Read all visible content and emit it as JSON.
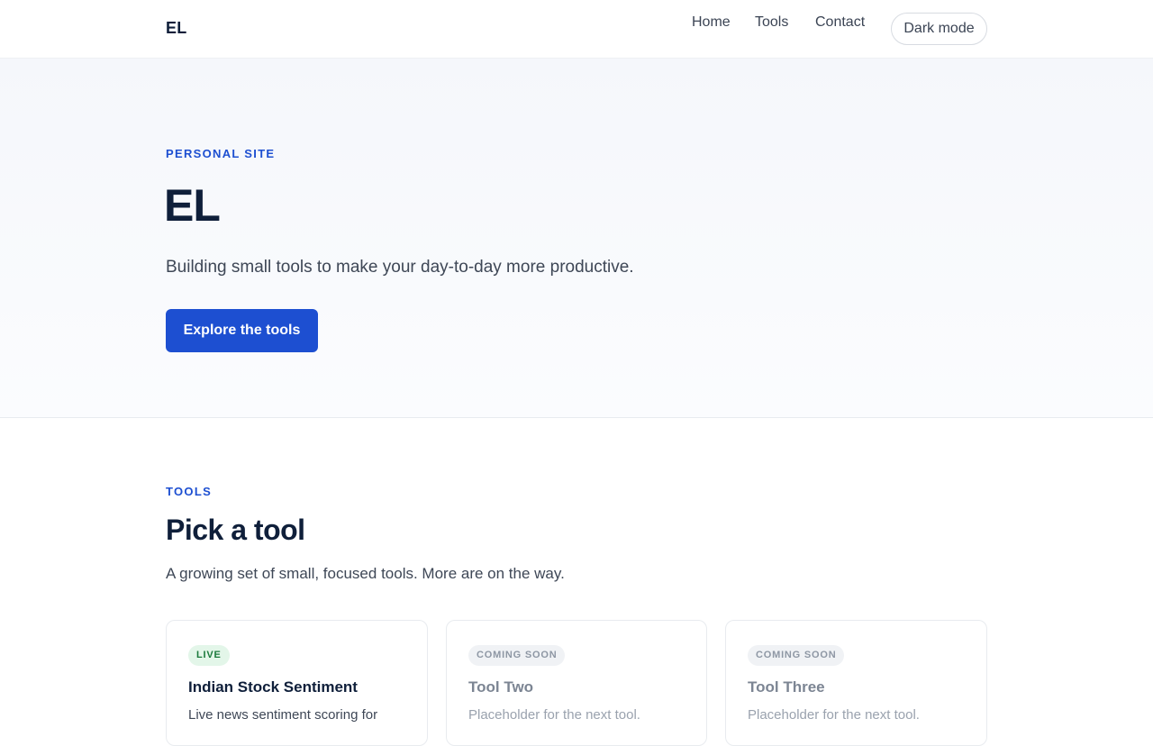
{
  "header": {
    "logo": "EL",
    "nav": [
      {
        "label": "Home"
      },
      {
        "label": "Tools"
      },
      {
        "label": "Contact"
      }
    ],
    "dark_mode_label": "Dark mode"
  },
  "hero": {
    "eyebrow": "PERSONAL SITE",
    "title": "EL",
    "subtitle": "Building small tools to make your day-to-day more productive.",
    "cta_label": "Explore the tools"
  },
  "tools": {
    "eyebrow": "TOOLS",
    "title": "Pick a tool",
    "subtitle": "A growing set of small, focused tools. More are on the way.",
    "cards": [
      {
        "badge": "LIVE",
        "title": "Indian Stock Sentiment",
        "description": "Live news sentiment scoring for"
      },
      {
        "badge": "COMING SOON",
        "title": "Tool Two",
        "description": "Placeholder for the next tool."
      },
      {
        "badge": "COMING SOON",
        "title": "Tool Three",
        "description": "Placeholder for the next tool."
      }
    ]
  },
  "colors": {
    "accent": "#1d4fd1",
    "live_badge_bg": "#e3f6e9",
    "live_badge_text": "#1b7a3c",
    "soon_badge_bg": "#f0f2f5",
    "soon_badge_text": "#8e97a4"
  }
}
